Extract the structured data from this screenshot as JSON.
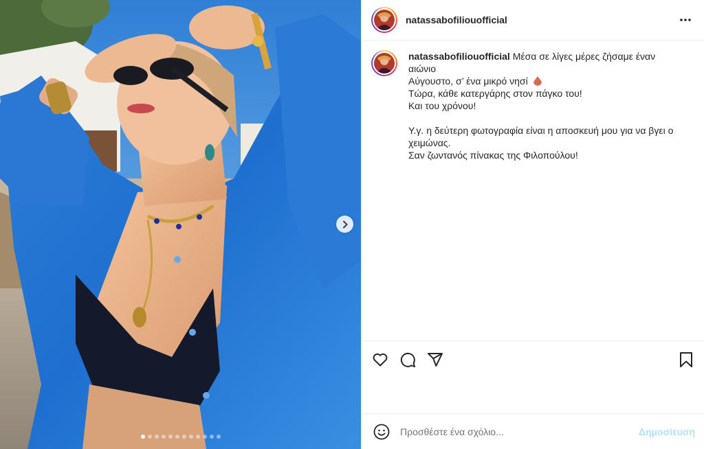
{
  "post": {
    "username": "natassabofiliouofficial",
    "caption_lines": [
      "Μέσα σε λίγες μέρες ζήσαμε έναν αιώνιο",
      "Αύγουστο, σ’ ένα μικρό νησί",
      "Τώρα, κάθε κατεργάρης στον πάγκο του!",
      "Και του χρόνου!",
      "Υ.γ. η δεύτερη φωτογραφία είναι η αποσκευή μου για να βγει ο",
      "χειμώνας.",
      "Σαν ζωντανός πίνακας της Φιλοπούλου!"
    ],
    "caption_emoji": "shell-icon"
  },
  "carousel": {
    "total_slides": 12,
    "active_slide": 1,
    "next_icon": "chevron-right-icon"
  },
  "actions": {
    "like_icon": "heart-icon",
    "comment_icon": "comment-icon",
    "share_icon": "paper-plane-icon",
    "save_icon": "bookmark-icon"
  },
  "comment": {
    "placeholder": "Προσθέστε ένα σχόλιο...",
    "post_label": "Δημοσίευση",
    "emoji_icon": "smiley-icon"
  },
  "colors": {
    "post_button_disabled": "#b2dffc",
    "text": "#262626",
    "border": "#efefef"
  }
}
